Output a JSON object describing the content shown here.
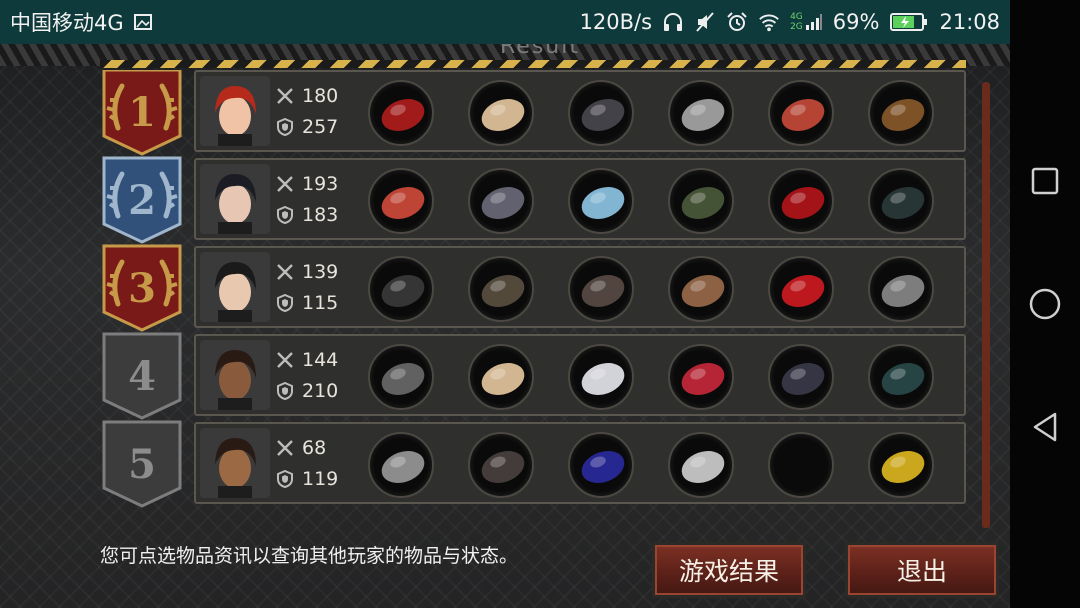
{
  "status_bar": {
    "carrier": "中国移动4G",
    "speed": "120B/s",
    "network": "4G",
    "network2": "2G",
    "battery": "69%",
    "time": "21:08"
  },
  "header": {
    "title": "Result"
  },
  "players": [
    {
      "rank": "1",
      "attack": "180",
      "defense": "257",
      "rank_color": "#c79a4a",
      "items": [
        "wing-blade",
        "winged-tiara",
        "dark-armor",
        "metal-disc",
        "dynamite-belt",
        "wooden-cross"
      ]
    },
    {
      "rank": "2",
      "attack": "193",
      "defense": "183",
      "rank_color": "#9fb6cc",
      "items": [
        "katana",
        "dark-tiara",
        "chain-mail",
        "wooden-staff",
        "red-platform-heels",
        "scope"
      ]
    },
    {
      "rank": "3",
      "attack": "139",
      "defense": "115",
      "rank_color": "#c79a4a",
      "items": [
        "sniper-rifle",
        "combat-helmet",
        "leather-armor",
        "power-cell",
        "red-heels",
        "magazine"
      ]
    },
    {
      "rank": "4",
      "attack": "144",
      "defense": "210",
      "rank_color": "#7d7d7d",
      "items": [
        "bow",
        "winged-tiara",
        "white-shirt",
        "bead-necklace",
        "dark-gauntlet",
        "baton"
      ]
    },
    {
      "rank": "5",
      "attack": "68",
      "defense": "119",
      "rank_color": "#7d7d7d",
      "items": [
        "shuriken",
        "chain-hood",
        "blue-robe",
        "white-boots",
        "empty",
        "gold-ribbon"
      ]
    }
  ],
  "footer": {
    "hint": "您可点选物品资讯以查询其他玩家的物品与状态。",
    "results_button": "游戏结果",
    "exit_button": "退出"
  }
}
